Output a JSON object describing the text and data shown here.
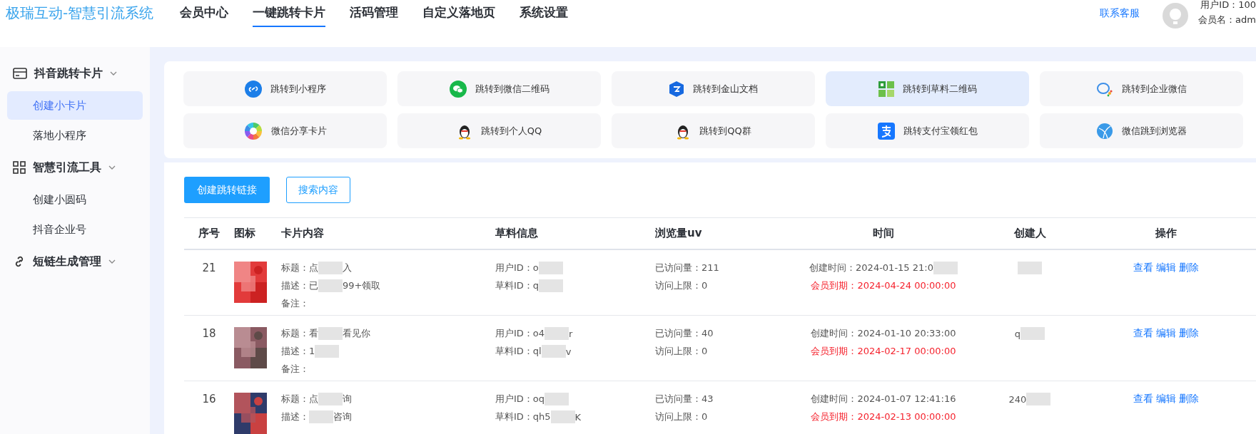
{
  "header": {
    "logo": "极瑞互动-智慧引流系统",
    "nav": [
      {
        "label": "会员中心",
        "selected": false
      },
      {
        "label": "一键跳转卡片",
        "selected": true
      },
      {
        "label": "活码管理",
        "selected": false
      },
      {
        "label": "自定义落地页",
        "selected": false
      },
      {
        "label": "系统设置",
        "selected": false
      }
    ],
    "support": "联系客服",
    "user_id": "用户ID：100",
    "user_name": "会员名：adm"
  },
  "sidebar": [
    {
      "label": "抖音跳转卡片",
      "kind": "card",
      "items": [
        {
          "label": "创建小卡片",
          "selected": true
        },
        {
          "label": "落地小程序",
          "selected": false
        }
      ]
    },
    {
      "label": "智慧引流工具",
      "kind": "grid",
      "items": [
        {
          "label": "创建小圆码",
          "selected": false
        },
        {
          "label": "抖音企业号",
          "selected": false
        }
      ]
    },
    {
      "label": "短链生成管理",
      "kind": "link"
    }
  ],
  "jump_buttons": [
    {
      "label": "跳转到小程序",
      "kind": "miniprogram",
      "selected": false
    },
    {
      "label": "跳转到微信二维码",
      "kind": "wechat",
      "selected": false
    },
    {
      "label": "跳转到金山文档",
      "kind": "doc",
      "selected": false
    },
    {
      "label": "跳转到草料二维码",
      "kind": "qr",
      "selected": true
    },
    {
      "label": "跳转到企业微信",
      "kind": "wecom",
      "selected": false
    },
    {
      "label": "微信分享卡片",
      "kind": "share",
      "selected": false
    },
    {
      "label": "跳转到个人QQ",
      "kind": "qq",
      "selected": false
    },
    {
      "label": "跳转到QQ群",
      "kind": "qq",
      "selected": false
    },
    {
      "label": "跳转支付宝领红包",
      "kind": "alipay",
      "selected": false
    },
    {
      "label": "微信跳到浏览器",
      "kind": "browser",
      "selected": false
    }
  ],
  "toolbar": {
    "create": "创建跳转链接",
    "search": "搜索内容"
  },
  "table": {
    "columns": [
      "序号",
      "图标",
      "卡片内容",
      "草料信息",
      "浏览量uv",
      "时间",
      "创建人",
      "操作"
    ],
    "rows": [
      {
        "no": "21",
        "content": [
          [
            {
              "kind": "text",
              "text": "标题：点"
            },
            {
              "kind": "redacted"
            },
            {
              "kind": "text",
              "text": "入"
            }
          ],
          [
            {
              "kind": "text",
              "text": "描述：已"
            },
            {
              "kind": "redacted"
            },
            {
              "kind": "text",
              "text": "99+领取"
            }
          ],
          [
            {
              "kind": "text",
              "text": "备注："
            }
          ]
        ],
        "caoliao": [
          [
            {
              "kind": "text",
              "text": "用户ID：o"
            },
            {
              "kind": "redacted"
            }
          ],
          [
            {
              "kind": "text",
              "text": "草料ID：q"
            },
            {
              "kind": "redacted"
            }
          ]
        ],
        "views": [
          "已访问量：211",
          "访问上限：0"
        ],
        "created": [
          {
            "kind": "text",
            "text": "创建时间：2024-01-15 21:0"
          },
          {
            "kind": "redacted"
          }
        ],
        "expire": "会员到期：2024-04-24 00:00:00",
        "creator": [
          {
            "kind": "redacted"
          }
        ],
        "actions": [
          "查看",
          "编辑",
          "删除"
        ]
      },
      {
        "no": "18",
        "content": [
          [
            {
              "kind": "text",
              "text": "标题：看"
            },
            {
              "kind": "redacted"
            },
            {
              "kind": "text",
              "text": "看见你"
            }
          ],
          [
            {
              "kind": "text",
              "text": "描述：1"
            },
            {
              "kind": "redacted"
            }
          ],
          [
            {
              "kind": "text",
              "text": "备注："
            }
          ]
        ],
        "caoliao": [
          [
            {
              "kind": "text",
              "text": "用户ID：o4"
            },
            {
              "kind": "redacted"
            },
            {
              "kind": "text",
              "text": "r"
            }
          ],
          [
            {
              "kind": "text",
              "text": "草料ID：ql"
            },
            {
              "kind": "redacted"
            },
            {
              "kind": "text",
              "text": "v"
            }
          ]
        ],
        "views": [
          "已访问量：40",
          "访问上限：0"
        ],
        "created": [
          {
            "kind": "text",
            "text": "创建时间：2024-01-10 20:33:00"
          }
        ],
        "expire": "会员到期：2024-02-17 00:00:00",
        "creator": [
          {
            "kind": "text",
            "text": "q"
          },
          {
            "kind": "redacted"
          }
        ],
        "actions": [
          "查看",
          "编辑",
          "删除"
        ]
      },
      {
        "no": "16",
        "content": [
          [
            {
              "kind": "text",
              "text": "标题：点"
            },
            {
              "kind": "redacted"
            },
            {
              "kind": "text",
              "text": "询"
            }
          ],
          [
            {
              "kind": "text",
              "text": "描述："
            },
            {
              "kind": "redacted"
            },
            {
              "kind": "text",
              "text": "咨询"
            }
          ]
        ],
        "caoliao": [
          [
            {
              "kind": "text",
              "text": "用户ID：oq"
            },
            {
              "kind": "redacted"
            }
          ],
          [
            {
              "kind": "text",
              "text": "草料ID：qh5"
            },
            {
              "kind": "redacted"
            },
            {
              "kind": "text",
              "text": "K"
            }
          ]
        ],
        "views": [
          "已访问量：43",
          "访问上限：0"
        ],
        "created": [
          {
            "kind": "text",
            "text": "创建时间：2024-01-07 12:41:16"
          }
        ],
        "expire": "会员到期：2024-02-13 00:00:00",
        "creator": [
          {
            "kind": "text",
            "text": "240"
          },
          {
            "kind": "redacted"
          }
        ],
        "actions": [
          "查看",
          "编辑",
          "删除"
        ]
      }
    ]
  }
}
